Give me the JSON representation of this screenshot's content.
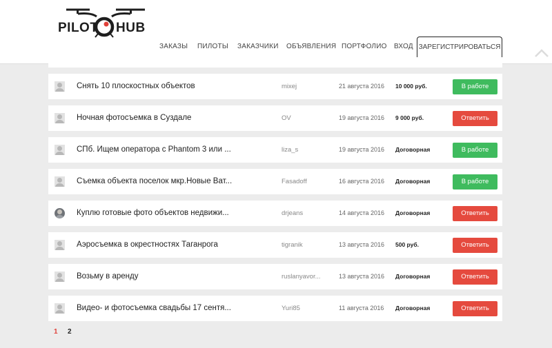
{
  "logo": {
    "left": "PILOT",
    "right": "HUB"
  },
  "nav": {
    "items": [
      "ЗАКАЗЫ",
      "ПИЛОТЫ",
      "ЗАКАЗЧИКИ",
      "ОБЪЯВЛЕНИЯ",
      "ПОРТФОЛИО",
      "ВХОД"
    ],
    "register": "ЗАРЕГИСТРИРОВАТЬСЯ"
  },
  "orders": [
    {
      "title": "Снять 10 плоскостных объектов",
      "user": "mixej",
      "date": "21 августа 2016",
      "price": "10 000 руб.",
      "status": "В работе",
      "status_color": "#3fbb5e",
      "avatar": "default"
    },
    {
      "title": "Ночная фотосъемка в Суздале",
      "user": "OV",
      "date": "19 августа 2016",
      "price": "9 000 руб.",
      "status": "Ответить",
      "status_color": "#e54a3e",
      "avatar": "default"
    },
    {
      "title": "СПб. Ищем оператора с Phantom 3 или ...",
      "user": "liza_s",
      "date": "19 августа 2016",
      "price": "Договорная",
      "status": "В работе",
      "status_color": "#3fbb5e",
      "avatar": "default"
    },
    {
      "title": "Съемка объекта поселок мкр.Новые Ват...",
      "user": "Fasadoff",
      "date": "16 августа 2016",
      "price": "Договорная",
      "status": "В работе",
      "status_color": "#3fbb5e",
      "avatar": "default"
    },
    {
      "title": "Куплю готовые фото объектов недвижи...",
      "user": "drjeans",
      "date": "14 августа 2016",
      "price": "Договорная",
      "status": "Ответить",
      "status_color": "#e54a3e",
      "avatar": "photo"
    },
    {
      "title": "Аэросъемка в окрестностях Таганрога",
      "user": "tigranik",
      "date": "13 августа 2016",
      "price": "500 руб.",
      "status": "Ответить",
      "status_color": "#e54a3e",
      "avatar": "default"
    },
    {
      "title": "Возьму в аренду",
      "user": "ruslanyavor...",
      "date": "13 августа 2016",
      "price": "Договорная",
      "status": "Ответить",
      "status_color": "#e54a3e",
      "avatar": "default"
    },
    {
      "title": "Видео- и фотосъемка свадьбы 17 сентя...",
      "user": "Yuri85",
      "date": "11 августа 2016",
      "price": "Договорная",
      "status": "Ответить",
      "status_color": "#e54a3e",
      "avatar": "default"
    }
  ],
  "pagination": {
    "current": "1",
    "next": "2"
  },
  "colors": {
    "accent_red": "#e54a3e",
    "accent_green": "#3fbb5e",
    "background": "#ececec"
  }
}
